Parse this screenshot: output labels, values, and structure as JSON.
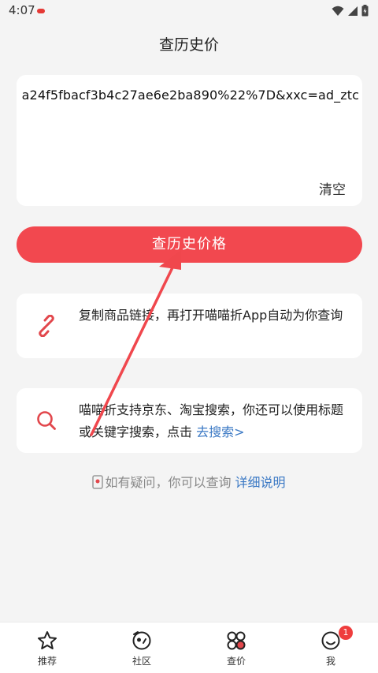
{
  "status": {
    "time": "4:07"
  },
  "page": {
    "title": "查历史价"
  },
  "input": {
    "value": "a24f5fbacf3b4c27ae6e2ba890%22%7D&xxc=ad_ztc",
    "clear_label": "清空"
  },
  "main_button": {
    "label": "查历史价格"
  },
  "tips": [
    {
      "icon": "link-icon",
      "text": "复制商品链接，再打开喵喵折App自动为你查询"
    },
    {
      "icon": "search-icon",
      "text": "喵喵折支持京东、淘宝搜索，你还可以使用标题或关键字搜索，点击 ",
      "link": "去搜索>"
    }
  ],
  "help": {
    "text": "如有疑问，你可以查询 ",
    "link": "详细说明"
  },
  "tabs": [
    {
      "icon": "star-icon",
      "label": "推荐"
    },
    {
      "icon": "community-icon",
      "label": "社区"
    },
    {
      "icon": "price-icon",
      "label": "查价"
    },
    {
      "icon": "smile-icon",
      "label": "我",
      "badge": "1"
    }
  ],
  "colors": {
    "accent": "#f2484f",
    "link": "#3a78c4",
    "background": "#f4f4f4"
  }
}
